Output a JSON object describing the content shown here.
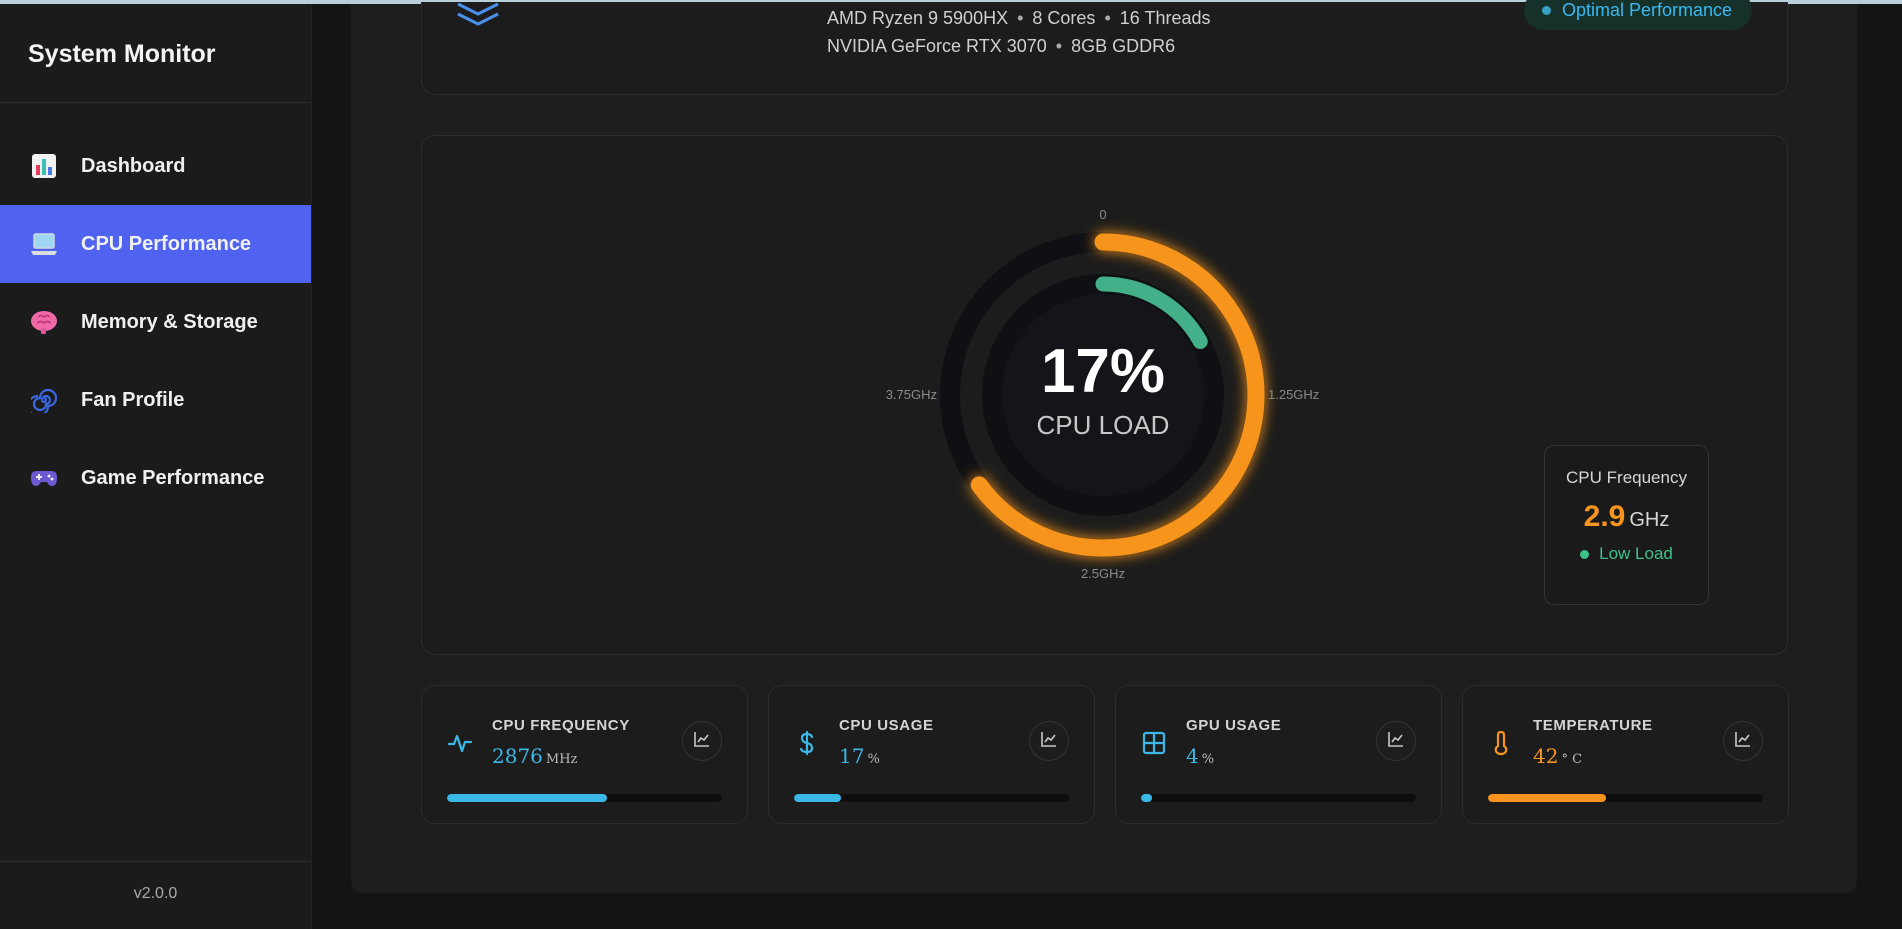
{
  "app": {
    "title": "System Monitor",
    "version": "v2.0.0"
  },
  "nav": [
    {
      "label": "Dashboard",
      "icon": "bar-chart-icon",
      "active": false
    },
    {
      "label": "CPU Performance",
      "icon": "laptop-icon",
      "active": true
    },
    {
      "label": "Memory & Storage",
      "icon": "brain-icon",
      "active": false
    },
    {
      "label": "Fan Profile",
      "icon": "cyclone-icon",
      "active": false
    },
    {
      "label": "Game Performance",
      "icon": "gamepad-icon",
      "active": false
    }
  ],
  "system": {
    "cpu_name": "AMD Ryzen 9 5900HX",
    "cpu_cores": "8 Cores",
    "cpu_threads": "16 Threads",
    "gpu_name": "NVIDIA GeForce RTX 3070",
    "gpu_mem": "8GB GDDR6",
    "status": "Optimal Performance"
  },
  "gauge": {
    "load_text": "17%",
    "load_label": "CPU LOAD",
    "inner_fraction": 0.17,
    "outer_fraction": 0.65,
    "tick_top": "0",
    "tick_right": "1.25GHz",
    "tick_bottom": "2.5GHz",
    "tick_left": "3.75GHz"
  },
  "frequency": {
    "title": "CPU Frequency",
    "value": "2.9",
    "unit": "GHz",
    "status": "Low Load"
  },
  "stats": [
    {
      "label": "CPU FREQUENCY",
      "value": "2876",
      "unit": "MHz",
      "fraction": 0.58,
      "color": "#3ab8e8",
      "icon": "activity-icon"
    },
    {
      "label": "CPU USAGE",
      "value": "17",
      "unit": "%",
      "fraction": 0.17,
      "color": "#3ab8e8",
      "icon": "dollar-icon"
    },
    {
      "label": "GPU USAGE",
      "value": "4",
      "unit": "%",
      "fraction": 0.04,
      "color": "#3ab8e8",
      "icon": "grid-icon"
    },
    {
      "label": "TEMPERATURE",
      "value": "42",
      "unit": "° C",
      "fraction": 0.43,
      "color": "#f7941d",
      "icon": "thermometer-icon"
    }
  ],
  "colors": {
    "accent": "#4f63f0",
    "orange": "#f7941d",
    "green": "#3cc28a",
    "blue": "#3ab8e8"
  }
}
